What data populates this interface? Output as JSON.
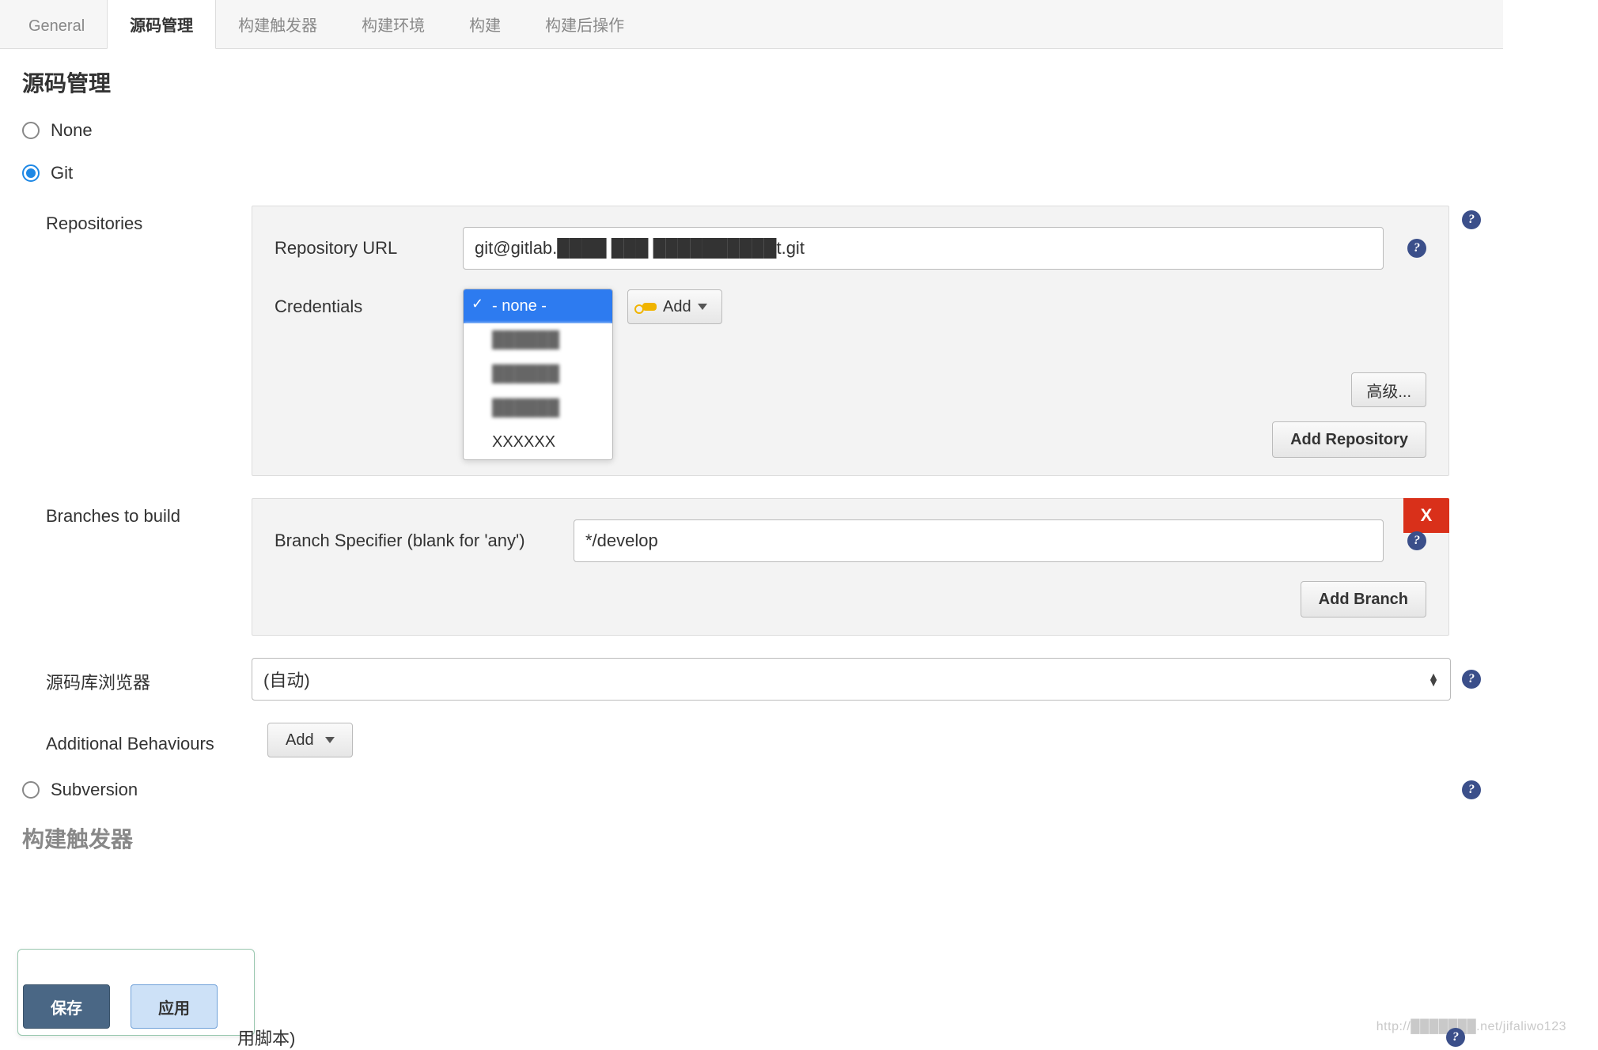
{
  "tabs": [
    {
      "label": "General"
    },
    {
      "label": "源码管理"
    },
    {
      "label": "构建触发器"
    },
    {
      "label": "构建环境"
    },
    {
      "label": "构建"
    },
    {
      "label": "构建后操作"
    }
  ],
  "section_title": "源码管理",
  "scm": {
    "none": "None",
    "git": "Git",
    "subversion": "Subversion"
  },
  "repositories": {
    "label": "Repositories",
    "url_label": "Repository URL",
    "url_value": "git@gitlab.████ ███ ██████████t.git",
    "credentials_label": "Credentials",
    "credentials_options": [
      {
        "label": "- none -",
        "selected": true
      },
      {
        "label": "██████",
        "blur": true
      },
      {
        "label": "██████",
        "blur": true
      },
      {
        "label": "██████",
        "blur": true
      },
      {
        "label": "XXXXXX"
      }
    ],
    "add_btn": "Add",
    "advanced_btn": "高级...",
    "add_repo_btn": "Add Repository"
  },
  "branches": {
    "label": "Branches to build",
    "spec_label": "Branch Specifier (blank for 'any')",
    "spec_value": "*/develop",
    "add_branch_btn": "Add Branch",
    "close": "X"
  },
  "browser": {
    "label": "源码库浏览器",
    "value": "(自动)"
  },
  "behaviours": {
    "label": "Additional Behaviours",
    "add": "Add"
  },
  "next_section": "构建触发器",
  "scripted_tail": "用脚本)",
  "buttons": {
    "save": "保存",
    "apply": "应用"
  },
  "watermark": "http://███████.net/jifaliwo123"
}
